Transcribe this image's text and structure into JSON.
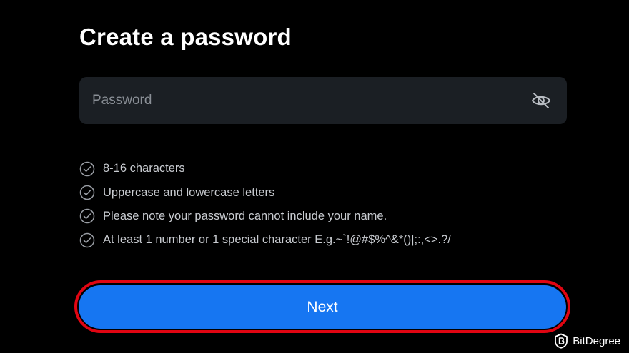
{
  "title": "Create a password",
  "password": {
    "placeholder": "Password",
    "value": "",
    "toggle_icon": "eye-off-icon"
  },
  "requirements": [
    {
      "text": "8-16 characters",
      "icon": "check-circle-icon"
    },
    {
      "text": "Uppercase and lowercase letters",
      "icon": "check-circle-icon"
    },
    {
      "text": "Please note your password cannot include your name.",
      "icon": "check-circle-icon"
    },
    {
      "text": "At least 1 number or 1 special character E.g.~`!@#$%^&*()|;:,<>.?/",
      "icon": "check-circle-icon"
    }
  ],
  "next_button": {
    "label": "Next",
    "color": "#1676f2",
    "highlight_color": "#e00512"
  },
  "watermark": {
    "text": "BitDegree",
    "icon": "bitdegree-logo-icon"
  },
  "colors": {
    "background": "#000000",
    "input_background": "#1b1f24",
    "text_primary": "#ffffff",
    "text_secondary": "#c8cbd0",
    "placeholder": "#8a8f96"
  }
}
